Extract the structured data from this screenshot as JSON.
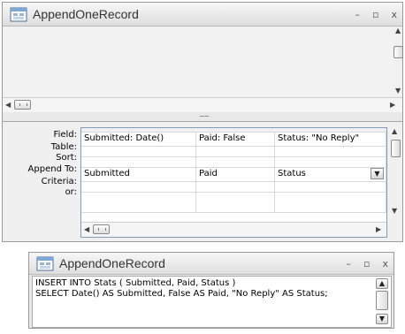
{
  "query_window": {
    "title": "AppendOneRecord",
    "controls": {
      "minimize": "–",
      "maximize": "▫",
      "close": "x"
    },
    "row_labels": [
      "Field:",
      "Table:",
      "Sort:",
      "Append To:",
      "Criteria:",
      "or:"
    ],
    "columns": [
      {
        "field": "Submitted: Date()",
        "append_to": "Submitted"
      },
      {
        "field": "Paid: False",
        "append_to": "Paid"
      },
      {
        "field": "Status: \"No Reply\"",
        "append_to": "Status"
      }
    ]
  },
  "sql_window": {
    "title": "AppendOneRecord",
    "controls": {
      "minimize": "–",
      "maximize": "▫",
      "close": "x"
    },
    "sql_lines": [
      "INSERT INTO Stats ( Submitted, Paid, Status )",
      "SELECT Date() AS Submitted, False AS Paid, \"No Reply\" AS Status;"
    ]
  },
  "icons": [
    "query-window-icon",
    "chevron-down-icon",
    "scroll-left-arrow-icon",
    "scroll-right-arrow-icon",
    "scroll-up-arrow-icon",
    "scroll-down-arrow-icon"
  ]
}
